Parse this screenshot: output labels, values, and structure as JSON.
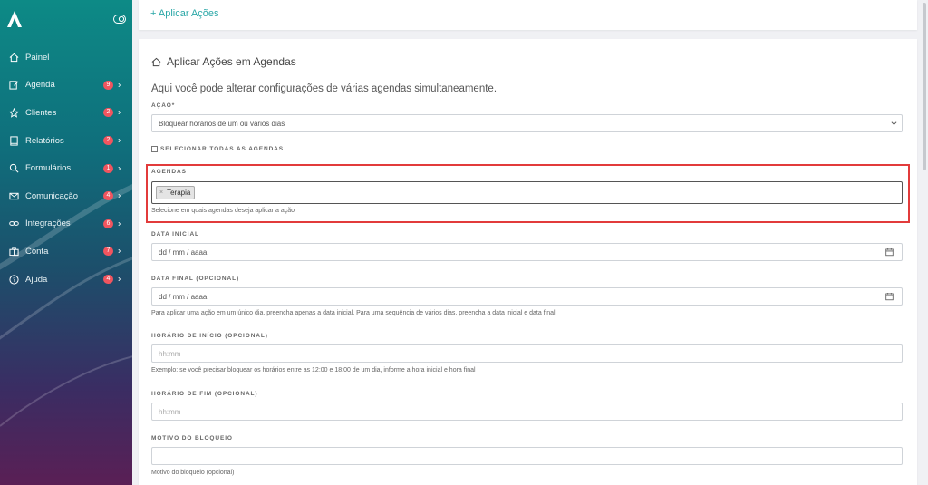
{
  "sidebar": {
    "items": [
      {
        "label": "Painel",
        "icon": "home-icon"
      },
      {
        "label": "Agenda",
        "icon": "edit-icon",
        "badge": "9"
      },
      {
        "label": "Clientes",
        "icon": "star-icon",
        "badge": "2"
      },
      {
        "label": "Relatórios",
        "icon": "book-icon",
        "badge": "2"
      },
      {
        "label": "Formulários",
        "icon": "search-icon",
        "badge": "1"
      },
      {
        "label": "Comunicação",
        "icon": "mail-icon",
        "badge": "4"
      },
      {
        "label": "Integrações",
        "icon": "link-icon",
        "badge": "6"
      },
      {
        "label": "Conta",
        "icon": "briefcase-icon",
        "badge": "7"
      },
      {
        "label": "Ajuda",
        "icon": "help-icon",
        "badge": "4"
      }
    ]
  },
  "top_card": {
    "apply_link": "+   Aplicar Ações"
  },
  "main": {
    "title": "Aplicar Ações em Agendas",
    "intro": "Aqui você pode alterar configurações de várias agendas simultaneamente.",
    "acao_label": "AÇÃO*",
    "acao_value": "Bloquear horários de um ou vários dias",
    "select_all_label": "SELECIONAR TODAS AS AGENDAS",
    "agendas_label": "AGENDAS",
    "agendas_tag": "Terapia",
    "agendas_tag_remove": "×",
    "agendas_help": "Selecione em quais agendas deseja aplicar a ação",
    "data_inicial_label": "DATA INICIAL",
    "data_inicial_placeholder": "dd / mm / aaaa",
    "data_final_label": "DATA FINAL (OPCIONAL)",
    "data_final_placeholder": "dd / mm / aaaa",
    "data_help": "Para aplicar uma ação em um único dia, preencha apenas a data inicial. Para uma sequência de vários dias, preencha a data inicial e data final.",
    "hora_inicio_label": "HORÁRIO DE INÍCIO (OPCIONAL)",
    "hora_inicio_placeholder": "hh:mm",
    "hora_help": "Exemplo: se você precisar bloquear os horários entre as 12:00 e 18:00 de um dia, informe a hora inicial e hora final",
    "hora_fim_label": "HORÁRIO DE FIM (OPCIONAL)",
    "hora_fim_placeholder": "hh:mm",
    "motivo_label": "MOTIVO DO BLOQUEIO",
    "motivo_help": "Motivo do bloqueio (opcional)"
  },
  "colors": {
    "accent": "#2aa7a7",
    "badge": "#f1555f",
    "highlight": "#e23b3b"
  }
}
